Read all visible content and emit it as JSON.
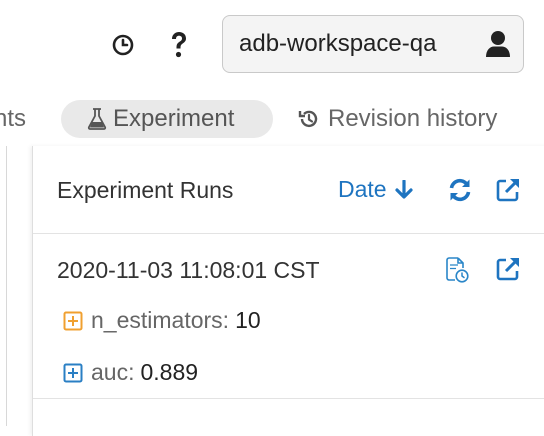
{
  "topbar": {
    "workspace_name": "adb-workspace-qa",
    "icons": [
      "clock-icon",
      "question-icon",
      "user-icon"
    ]
  },
  "tabs": {
    "partial_label": "nts",
    "experiment_label": "Experiment",
    "revision_label": "Revision history"
  },
  "runs_panel": {
    "title": "Experiment Runs",
    "sort_label": "Date",
    "accent_color": "#1e74c0",
    "runs": [
      {
        "timestamp": "2020-11-03 11:08:01 CST",
        "params": [
          {
            "key": "n_estimators:",
            "value": "10",
            "color": "#f0a030"
          }
        ],
        "metrics": [
          {
            "key": "auc:",
            "value": "0.889",
            "color": "#2a7fc4"
          }
        ]
      }
    ]
  }
}
